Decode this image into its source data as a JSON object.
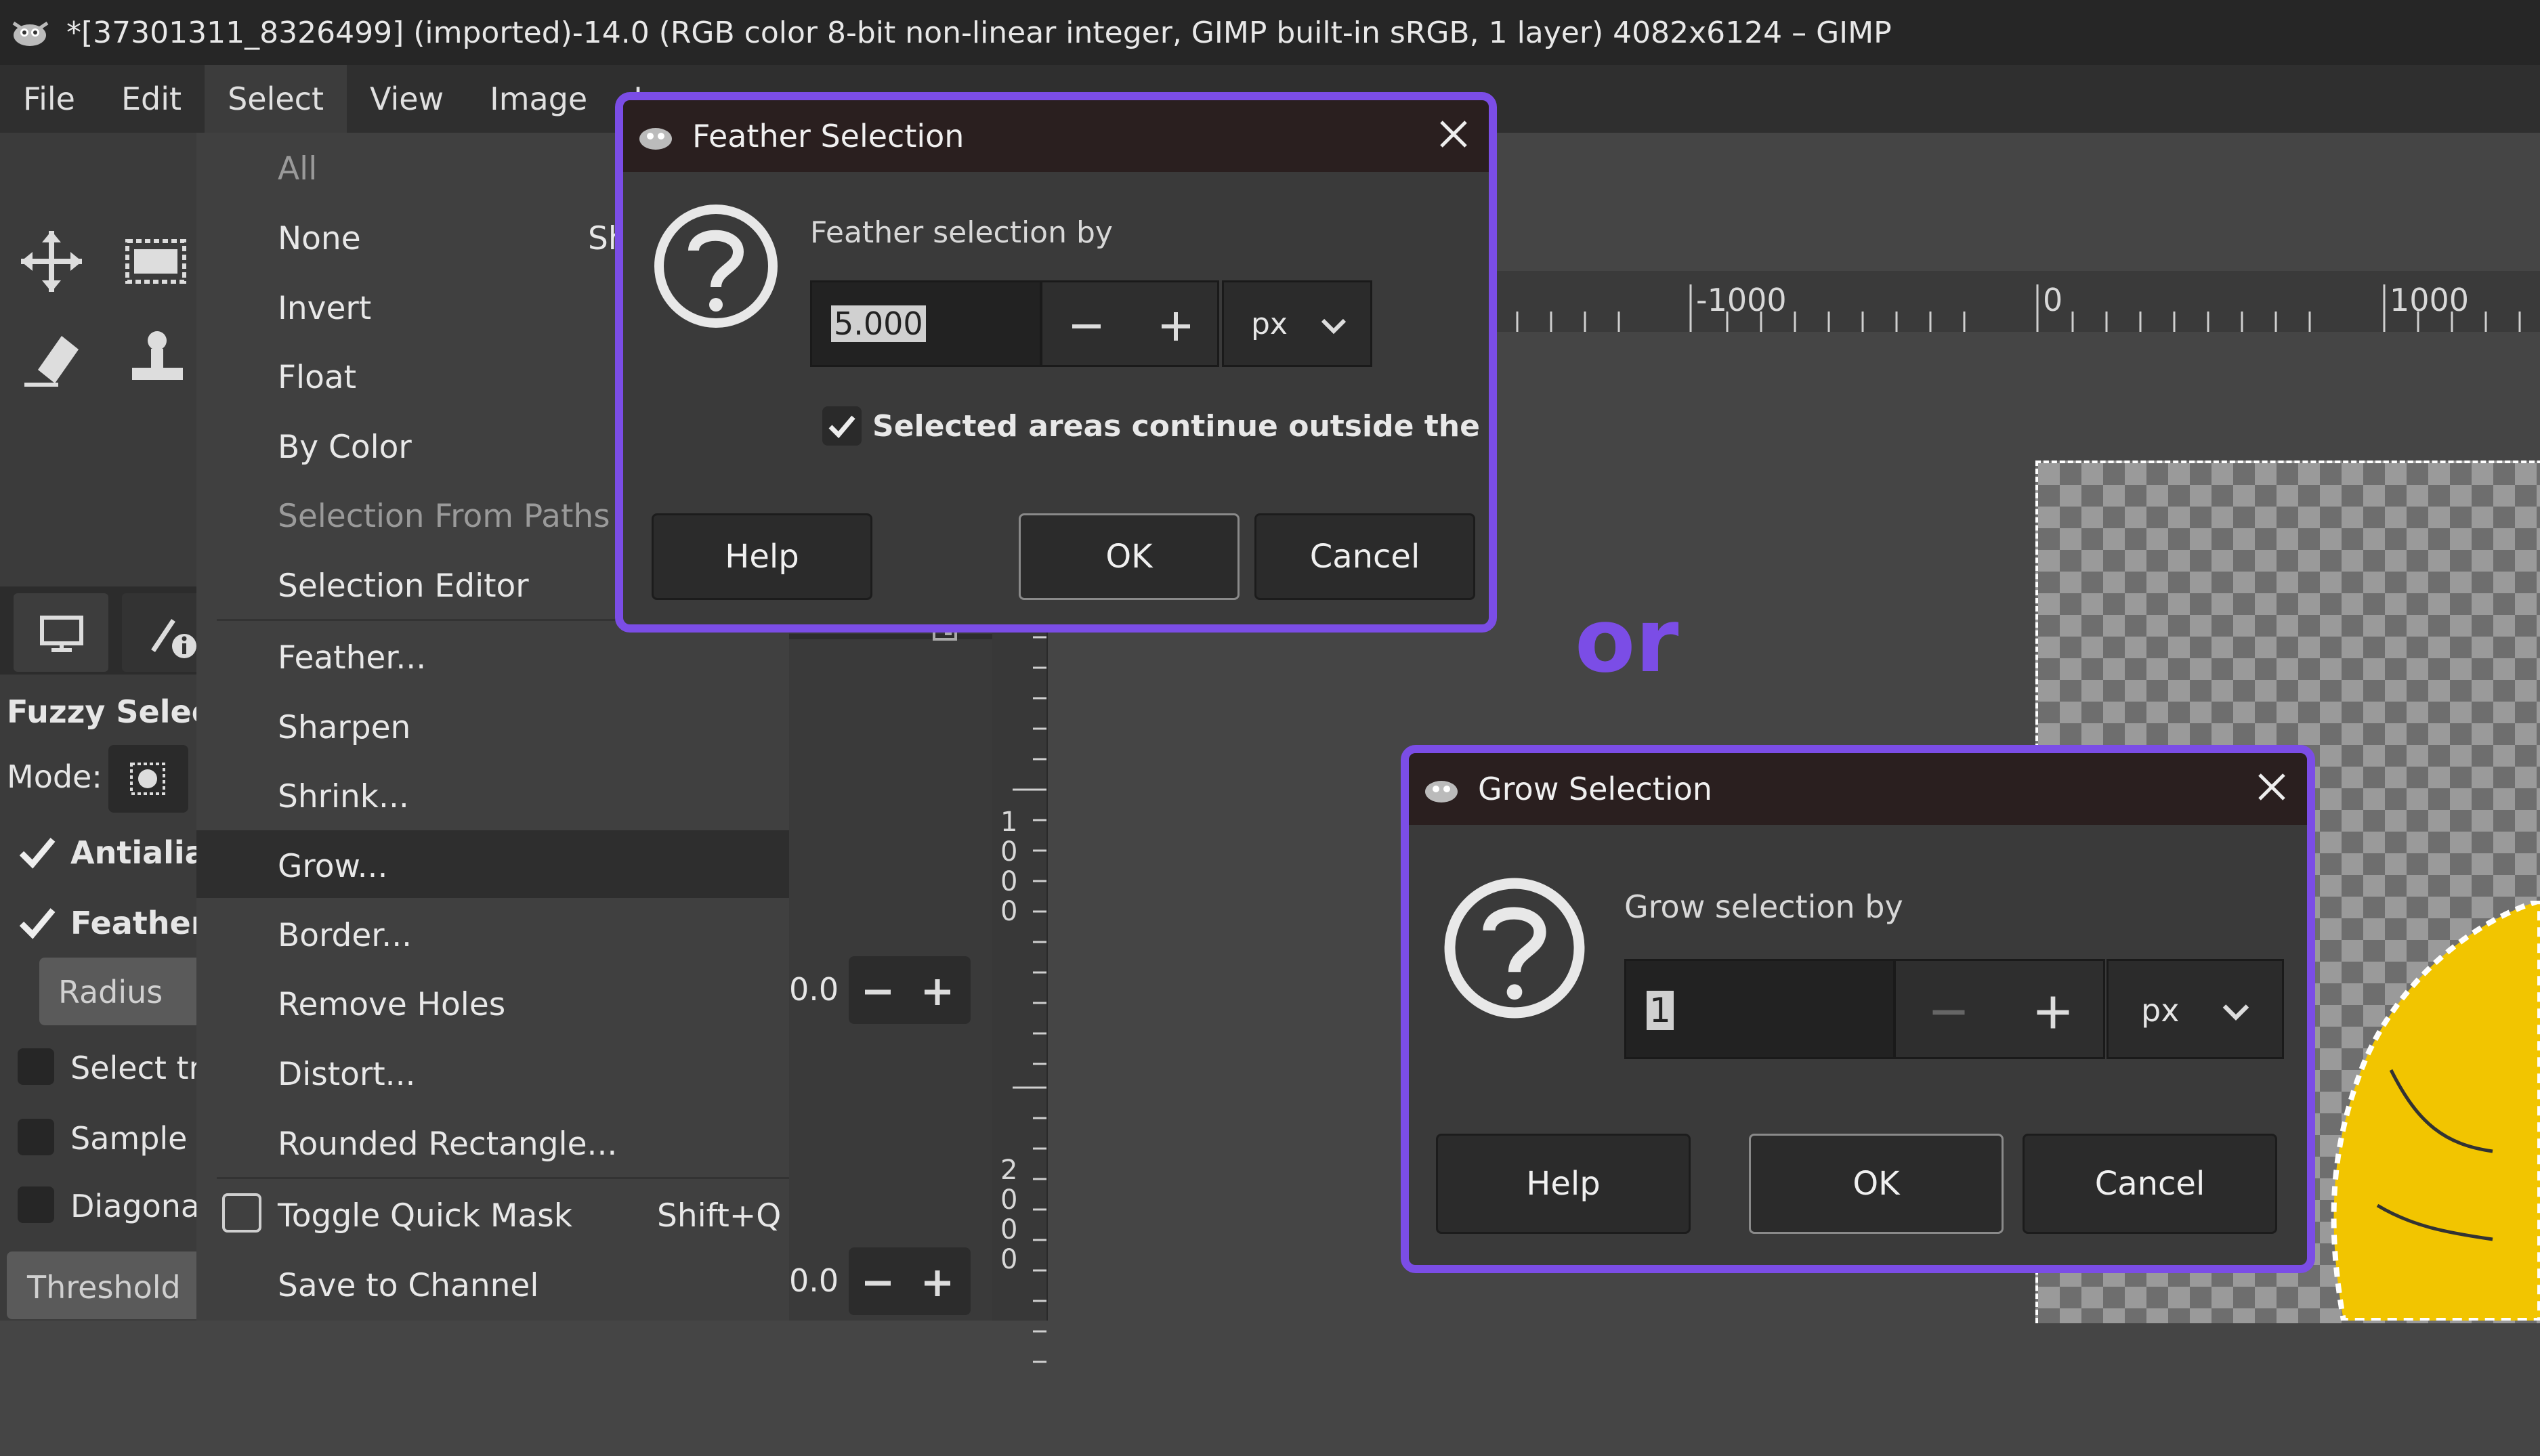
{
  "window": {
    "title": "*[37301311_8326499] (imported)-14.0 (RGB color 8-bit non-linear integer, GIMP built-in sRGB, 1 layer) 4082x6124 – GIMP"
  },
  "menubar": {
    "items": [
      "File",
      "Edit",
      "Select",
      "View",
      "Image",
      "La"
    ],
    "active": "Select"
  },
  "select_menu": {
    "items": [
      {
        "label": "All",
        "disabled": true
      },
      {
        "label": "None",
        "shortcut": "Sh"
      },
      {
        "label": "Invert"
      },
      {
        "label": "Float"
      },
      {
        "label": "By Color"
      },
      {
        "label": "Selection From Paths",
        "disabled": true
      },
      {
        "label": "Selection Editor"
      },
      {
        "label": "Feather..."
      },
      {
        "label": "Sharpen"
      },
      {
        "label": "Shrink..."
      },
      {
        "label": "Grow...",
        "highlighted": true
      },
      {
        "label": "Border..."
      },
      {
        "label": "Remove Holes"
      },
      {
        "label": "Distort..."
      },
      {
        "label": "Rounded Rectangle..."
      },
      {
        "label": "Toggle Quick Mask",
        "shortcut": "Shift+Q"
      },
      {
        "label": "Save to Channel"
      }
    ]
  },
  "tool_options": {
    "title": "Fuzzy Select",
    "mode_label": "Mode:",
    "antialias": "Antialias",
    "feather": "Feather",
    "radius": "Radius",
    "select_transparent": "Select tr",
    "sample_merged": "Sample r",
    "diagonal": "Diagona",
    "threshold": "Threshold",
    "value_a": "0.0",
    "value_b": "0.0"
  },
  "ruler": {
    "h_labels": [
      "-1000",
      "0",
      "1000"
    ],
    "v_labels": [
      "1000",
      "2000"
    ]
  },
  "feather_dialog": {
    "title": "Feather Selection",
    "prompt": "Feather selection by",
    "value": "5.000",
    "unit": "px",
    "checkbox_label": "Selected areas continue outside the image",
    "checkbox_checked": true,
    "help": "Help",
    "ok": "OK",
    "cancel": "Cancel"
  },
  "or_label": "or",
  "grow_dialog": {
    "title": "Grow Selection",
    "prompt": "Grow selection by",
    "value": "1",
    "unit": "px",
    "help": "Help",
    "ok": "OK",
    "cancel": "Cancel"
  },
  "colors": {
    "accent": "#7b4de6",
    "leaf": "#f2c500"
  }
}
